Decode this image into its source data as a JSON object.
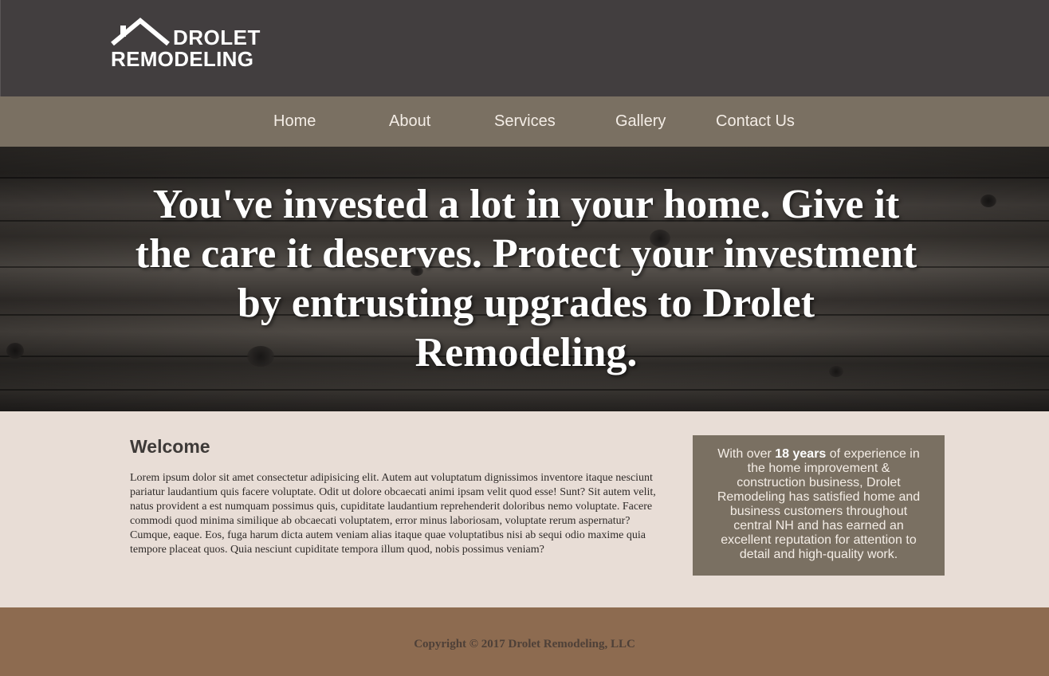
{
  "header": {
    "logo_line1": "DROLET",
    "logo_line2": "REMODELING",
    "background": "#423e3f"
  },
  "nav": {
    "background": "#7a7062",
    "items": [
      {
        "label": "Home"
      },
      {
        "label": "About"
      },
      {
        "label": "Services"
      },
      {
        "label": "Gallery"
      },
      {
        "label": "Contact Us"
      }
    ]
  },
  "hero": {
    "headline": "You've invested a lot in your home. Give it the care it deserves. Protect your investment by entrusting upgrades to Drolet Remodeling."
  },
  "welcome": {
    "title": "Welcome",
    "body": "Lorem ipsum dolor sit amet consectetur adipisicing elit. Autem aut voluptatum dignissimos inventore itaque nesciunt pariatur laudantium quis facere voluptate. Odit ut dolore obcaecati animi ipsam velit quod esse! Sunt? Sit autem velit, natus provident a est numquam possimus quis, cupiditate laudantium reprehenderit doloribus nemo voluptate. Facere commodi quod minima similique ab obcaecati voluptatem, error minus laboriosam, voluptate rerum aspernatur? Cumque, eaque. Eos, fuga harum dicta autem veniam alias itaque quae voluptatibus nisi ab sequi odio maxime quia tempore placeat quos. Quia nesciunt cupiditate tempora illum quod, nobis possimus veniam?"
  },
  "infobox": {
    "text_before": "With over ",
    "highlight": "18 years",
    "text_after": " of experience in the home improvement & construction business, Drolet Remodeling has satisfied home and business customers throughout central NH and has earned an excellent reputation for attention to detail and high-quality work."
  },
  "footer": {
    "copyright": "Copyright © 2017 Drolet Remodeling, LLC",
    "background": "#8d6b50"
  }
}
